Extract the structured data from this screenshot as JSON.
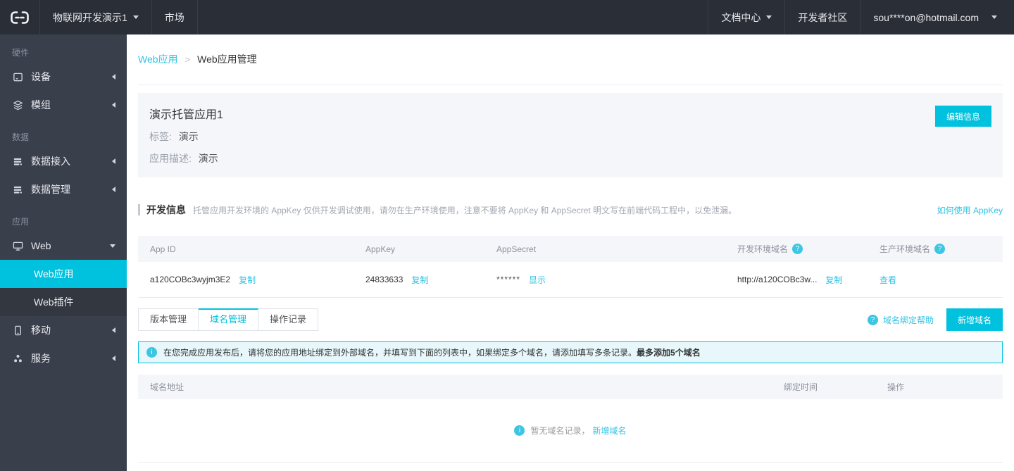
{
  "icons": {
    "question_glyph": "?",
    "info_glyph": "i"
  },
  "topbar": {
    "project_name": "物联网开发演示1",
    "market": "市场",
    "docs": "文档中心",
    "community": "开发者社区",
    "account": "sou****on@hotmail.com"
  },
  "sidebar": {
    "sections": [
      {
        "label": "硬件",
        "items": [
          {
            "label": "设备"
          },
          {
            "label": "模组"
          }
        ]
      },
      {
        "label": "数据",
        "items": [
          {
            "label": "数据接入"
          },
          {
            "label": "数据管理"
          }
        ]
      },
      {
        "label": "应用",
        "items": [
          {
            "label": "Web",
            "children": [
              {
                "label": "Web应用"
              },
              {
                "label": "Web插件"
              }
            ]
          },
          {
            "label": "移动"
          },
          {
            "label": "服务"
          }
        ]
      }
    ]
  },
  "breadcrumb": {
    "parent": "Web应用",
    "separator": ">",
    "current": "Web应用管理"
  },
  "app_card": {
    "title": "演示托管应用1",
    "tag_label": "标签:",
    "tag_value": "演示",
    "desc_label": "应用描述:",
    "desc_value": "演示",
    "edit_button": "编辑信息"
  },
  "dev_info": {
    "title": "开发信息",
    "description": "托管应用开发环境的 AppKey 仅供开发调试使用，请勿在生产环境使用，注意不要将 AppKey 和 AppSecret 明文写在前端代码工程中，以免泄漏。",
    "help_link": "如何使用 AppKey",
    "table": {
      "headers": [
        "App ID",
        "AppKey",
        "AppSecret",
        "开发环境域名",
        "生产环境域名"
      ],
      "row": {
        "app_id": "a120COBc3wyjm3E2",
        "app_key": "24833633",
        "app_secret": "******",
        "dev_domain": "http://a120COBc3w..."
      },
      "labels": {
        "copy": "复制",
        "show": "显示",
        "view": "查看"
      }
    }
  },
  "tabs": {
    "items": [
      "版本管理",
      "域名管理",
      "操作记录"
    ],
    "active": "域名管理",
    "help_link": "域名绑定帮助",
    "add_button": "新增域名"
  },
  "notice": {
    "text": "在您完成应用发布后，请将您的应用地址绑定到外部域名，并填写到下面的列表中，如果绑定多个域名，请添加填写多条记录。",
    "bold": "最多添加5个域名"
  },
  "domain_table": {
    "headers": [
      "域名地址",
      "绑定时间",
      "操作"
    ],
    "empty_text": "暂无域名记录，",
    "empty_link": "新增域名"
  },
  "colors": {
    "accent": "#00c1de",
    "topbar_bg": "#2a2e37",
    "sidebar_bg": "#3a3f4c"
  }
}
